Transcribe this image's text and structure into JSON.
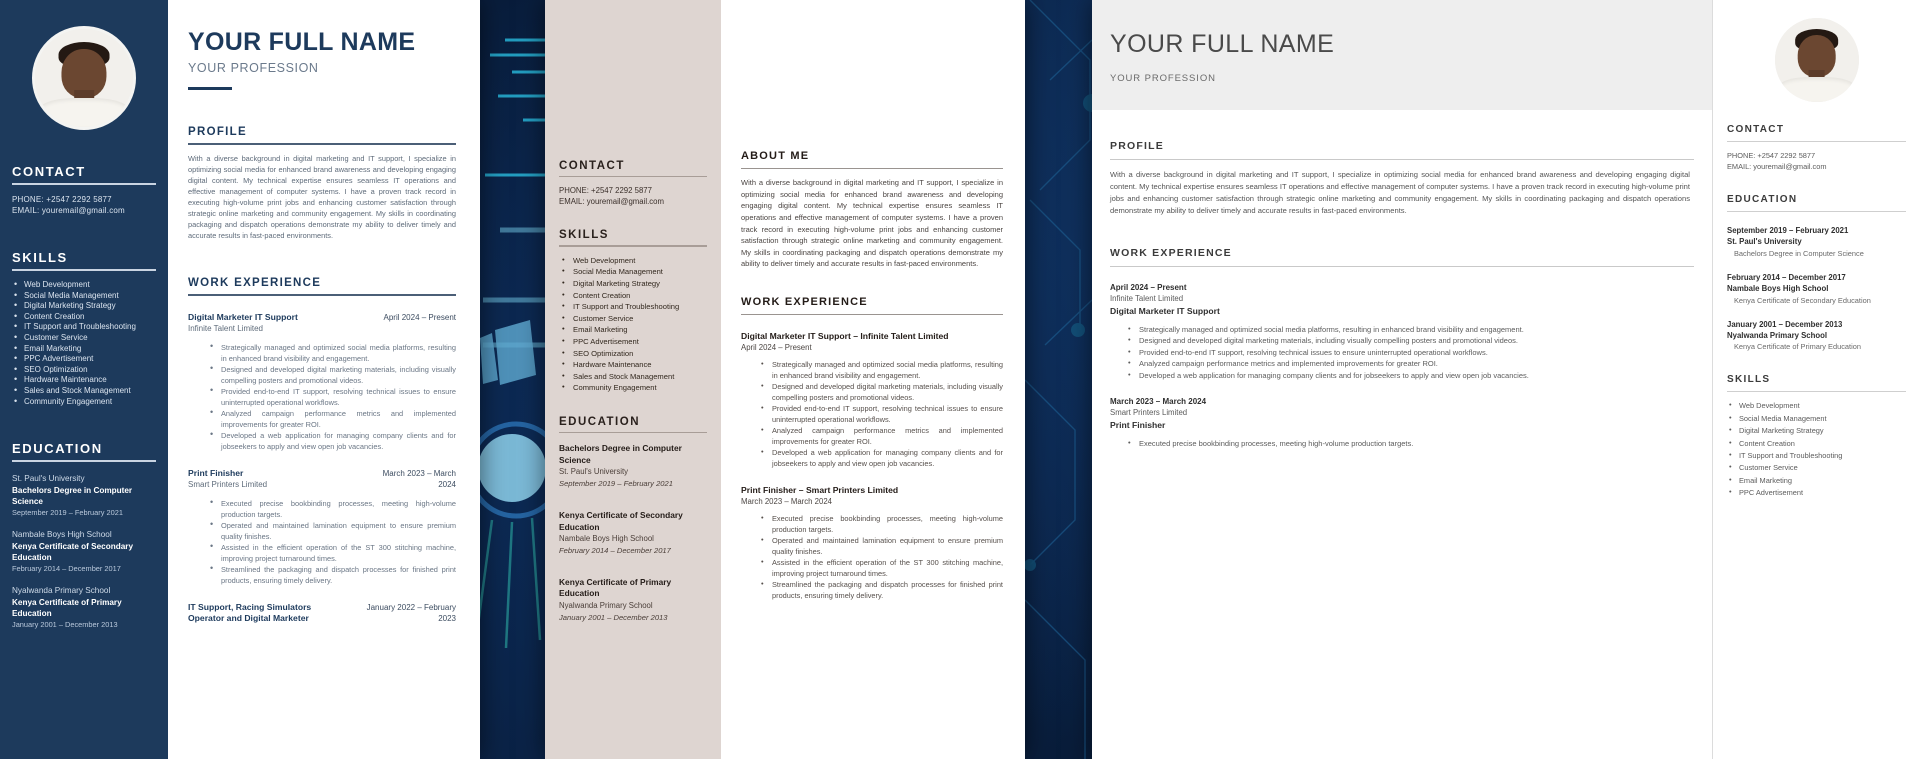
{
  "background": {
    "theme_color": "#0a1a33",
    "accent_color": "#3fd0ee"
  },
  "resume_common": {
    "name": "YOUR FULL NAME",
    "profession": "YOUR PROFESSION",
    "section_contact": "CONTACT",
    "section_skills": "SKILLS",
    "section_education": "EDUCATION",
    "section_profile": "PROFILE",
    "section_about": "ABOUT ME",
    "section_work": "WORK EXPERIENCE",
    "phone": "PHONE: +2547 2292 5877",
    "email": "EMAIL: youremail@gmail.com",
    "profile_text": "With a diverse background in digital marketing and IT support, I specialize in optimizing social media for enhanced brand awareness and developing engaging digital content. My technical expertise ensures seamless IT operations and effective management of computer systems. I have a proven track record in executing high-volume print jobs and enhancing customer satisfaction through strategic online marketing and community engagement. My skills in coordinating packaging and dispatch operations demonstrate my ability to deliver timely and accurate results in fast-paced environments.",
    "skills": [
      "Web Development",
      "Social Media Management",
      "Digital Marketing Strategy",
      "Content Creation",
      "IT Support and Troubleshooting",
      "Customer Service",
      "Email Marketing",
      "PPC Advertisement",
      "SEO Optimization",
      "Hardware Maintenance",
      "Sales and Stock Management",
      "Community Engagement"
    ],
    "education": [
      {
        "school": "St. Paul's University",
        "degree": "Bachelors Degree in Computer Science",
        "date": "September 2019 – February 2021"
      },
      {
        "school": "Nambale Boys High School",
        "degree": "Kenya Certificate of Secondary Education",
        "date": "February 2014 – December 2017"
      },
      {
        "school": "Nyalwanda Primary School",
        "degree": "Kenya Certificate of Primary Education",
        "date": "January 2001 – December 2013"
      }
    ],
    "jobs": [
      {
        "title": "Digital Marketer IT Support",
        "company": "Infinite Talent Limited",
        "date": "April 2024 – Present",
        "title_combined": "Digital Marketer IT Support – Infinite Talent Limited",
        "bullets": [
          "Strategically managed and optimized social media platforms, resulting in enhanced brand visibility and engagement.",
          "Designed and developed digital marketing materials, including visually compelling posters and promotional videos.",
          "Provided end-to-end IT support, resolving technical issues to ensure uninterrupted operational workflows.",
          "Analyzed campaign performance metrics and implemented improvements for greater ROI.",
          "Developed a web application for managing company clients and for jobseekers to apply and view open job vacancies."
        ]
      },
      {
        "title": "Print Finisher",
        "company": "Smart Printers Limited",
        "date": "March 2023 – March 2024",
        "title_combined": "Print Finisher – Smart Printers Limited",
        "bullets": [
          "Executed precise bookbinding processes, meeting high-volume production targets.",
          "Operated and maintained lamination equipment to ensure premium quality finishes.",
          "Assisted in the efficient operation of the ST 300 stitching machine, improving project turnaround times.",
          "Streamlined the packaging and dispatch processes for finished print products, ensuring timely delivery."
        ]
      },
      {
        "title": "IT Support, Racing Simulators Operator and Digital Marketer",
        "company": "",
        "date": "January 2022 – February 2023",
        "title_combined": "IT Support, Racing Simulators Operator and Digital Marketer",
        "bullets": []
      }
    ]
  }
}
